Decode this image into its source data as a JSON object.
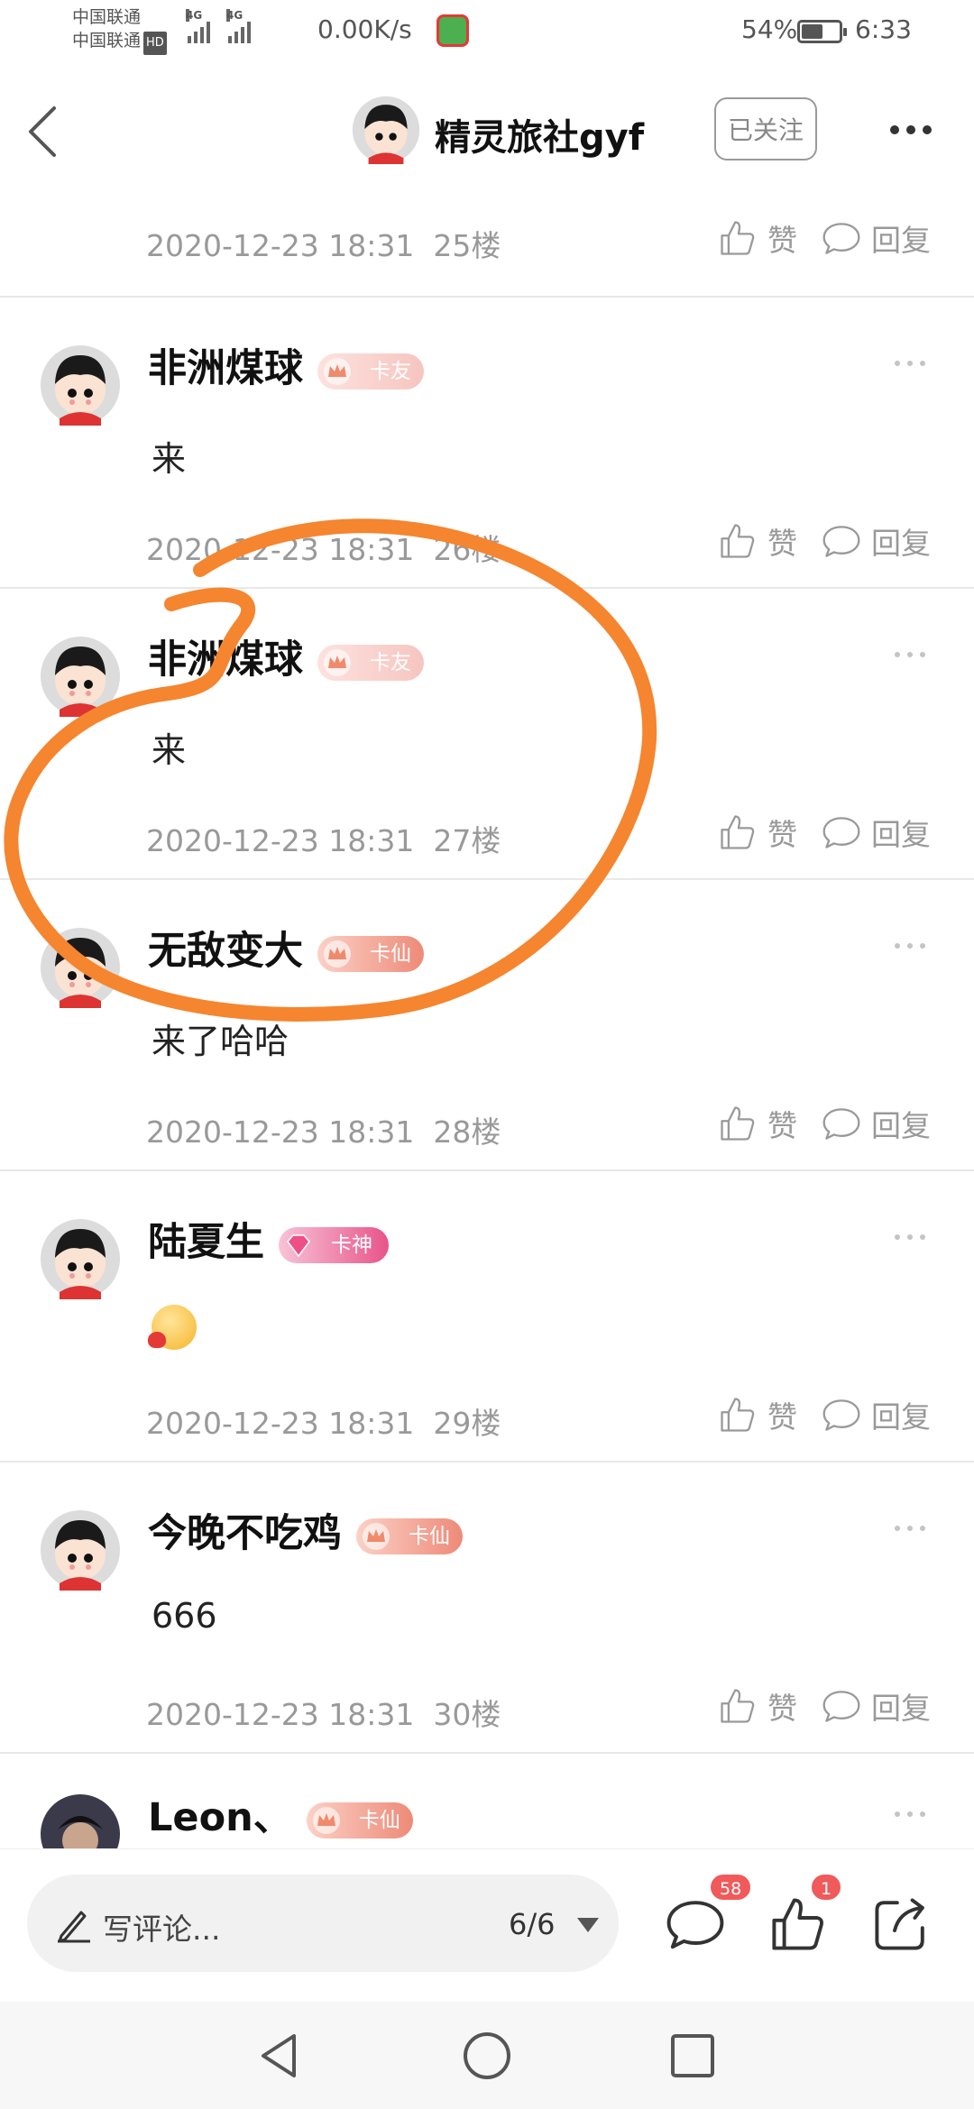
{
  "status_bar": {
    "carrier_1": "中国联通",
    "carrier_2": "中国联通",
    "hd": "HD",
    "network_1": "4G",
    "network_2": "4G",
    "speed": "0.00K/s",
    "battery": "54%",
    "battery_level": 0.54,
    "time": "6:33"
  },
  "header": {
    "title": "精灵旅社gyf",
    "follow_label": "已关注"
  },
  "top_partial": {
    "time": "2020-12-23 18:31",
    "floor": "25楼"
  },
  "actions": {
    "like": "赞",
    "reply": "回复"
  },
  "comments": [
    {
      "user": "非洲煤球",
      "badge": "卡友",
      "text": "来",
      "time": "2020-12-23 18:31",
      "floor": "26楼"
    },
    {
      "user": "非洲煤球",
      "badge": "卡友",
      "text": "来",
      "time": "2020-12-23 18:31",
      "floor": "27楼"
    },
    {
      "user": "无敌变大",
      "badge": "卡仙",
      "text": "来了哈哈",
      "time": "2020-12-23 18:31",
      "floor": "28楼"
    },
    {
      "user": "陆夏生",
      "badge": "卡神",
      "text": "",
      "time": "2020-12-23 18:31",
      "floor": "29楼"
    },
    {
      "user": "今晚不吃鸡",
      "badge": "卡仙",
      "text": "666",
      "time": "2020-12-23 18:31",
      "floor": "30楼"
    }
  ],
  "last_partial": {
    "user": "Leon、",
    "badge": "卡仙"
  },
  "bottom_bar": {
    "placeholder": "写评论...",
    "page": "6/6",
    "comment_count": "58",
    "like_count": "1"
  },
  "colors": {
    "annotation": "#f5852f",
    "badge_red": "#f05a5a"
  }
}
